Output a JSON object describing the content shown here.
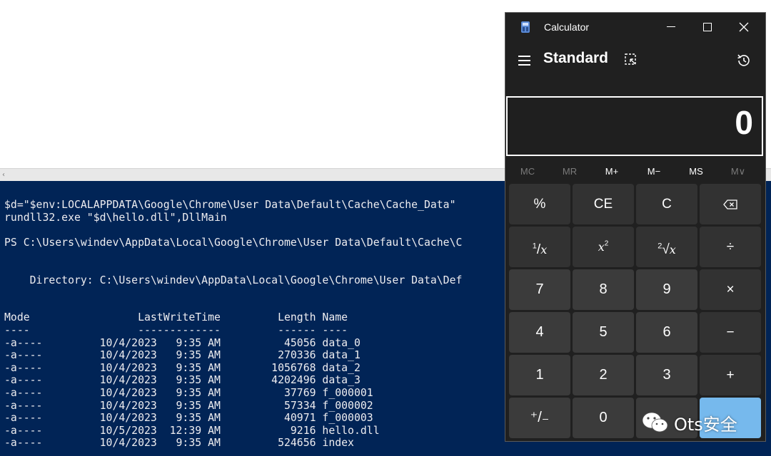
{
  "powershell": {
    "lines": [
      "$d=\"$env:LOCALAPPDATA\\Google\\Chrome\\User Data\\Default\\Cache\\Cache_Data\"",
      "rundll32.exe \"$d\\hello.dll\",DllMain",
      "",
      "PS C:\\Users\\windev\\AppData\\Local\\Google\\Chrome\\User Data\\Default\\Cache\\C",
      "",
      "",
      "    Directory: C:\\Users\\windev\\AppData\\Local\\Google\\Chrome\\User Data\\Def",
      "",
      "",
      "Mode                 LastWriteTime         Length Name",
      "----                 -------------         ------ ----",
      "-a----         10/4/2023   9:35 AM          45056 data_0",
      "-a----         10/4/2023   9:35 AM         270336 data_1",
      "-a----         10/4/2023   9:35 AM        1056768 data_2",
      "-a----         10/4/2023   9:35 AM        4202496 data_3",
      "-a----         10/4/2023   9:35 AM          37769 f_000001",
      "-a----         10/4/2023   9:35 AM          57334 f_000002",
      "-a----         10/4/2023   9:35 AM          40971 f_000003",
      "-a----         10/5/2023  12:39 AM           9216 hello.dll",
      "-a----         10/4/2023   9:35 AM         524656 index"
    ],
    "right_edge_fragment": "."
  },
  "calculator": {
    "window_title": "Calculator",
    "mode": "Standard",
    "display": "0",
    "memory": [
      {
        "label": "MC",
        "enabled": false
      },
      {
        "label": "MR",
        "enabled": false
      },
      {
        "label": "M+",
        "enabled": true
      },
      {
        "label": "M−",
        "enabled": true
      },
      {
        "label": "MS",
        "enabled": true
      },
      {
        "label": "M∨",
        "enabled": false
      }
    ],
    "keys": {
      "percent": "%",
      "ce": "CE",
      "c": "C",
      "seven": "7",
      "eight": "8",
      "nine": "9",
      "multiply": "×",
      "four": "4",
      "five": "5",
      "six": "6",
      "minus": "−",
      "one": "1",
      "two": "2",
      "three": "3",
      "plus": "+",
      "negate": "⁺/₋",
      "zero": "0"
    },
    "colors": {
      "window": "#202020",
      "fn_key": "#323232",
      "num_key": "#3b3b3b",
      "accent": "#76b9ed",
      "disabled_text": "#7a7a7a"
    }
  },
  "watermark": {
    "text": "Ots安全"
  }
}
